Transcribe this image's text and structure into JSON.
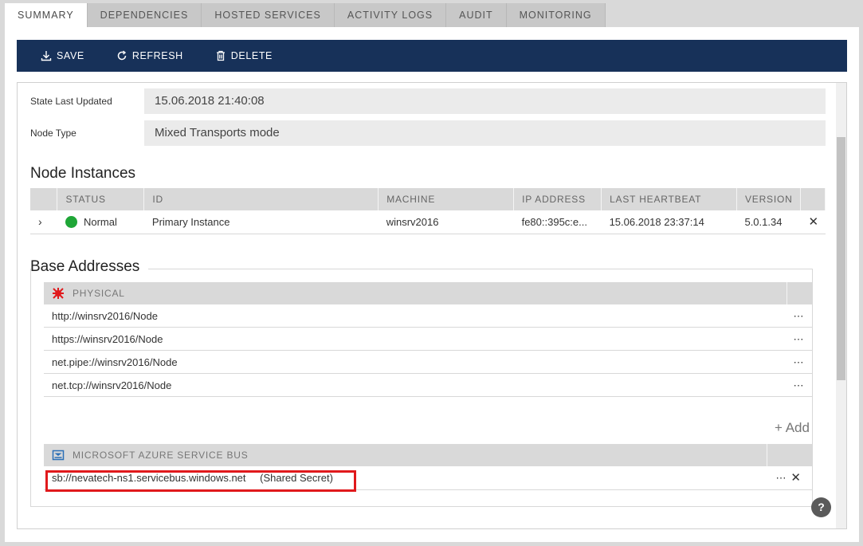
{
  "tabs": [
    {
      "label": "SUMMARY",
      "active": true
    },
    {
      "label": "DEPENDENCIES"
    },
    {
      "label": "HOSTED SERVICES"
    },
    {
      "label": "ACTIVITY LOGS"
    },
    {
      "label": "AUDIT"
    },
    {
      "label": "MONITORING"
    }
  ],
  "toolbar": {
    "save": "SAVE",
    "refresh": "REFRESH",
    "delete": "DELETE",
    "background": "#173159"
  },
  "fields": {
    "state_label": "State Last Updated",
    "state_value": "15.06.2018 21:40:08",
    "node_type_label": "Node Type",
    "node_type_value": "Mixed Transports mode"
  },
  "node_instances": {
    "title": "Node Instances",
    "columns": [
      "STATUS",
      "ID",
      "MACHINE",
      "IP ADDRESS",
      "LAST HEARTBEAT",
      "VERSION"
    ],
    "row": {
      "status": "Normal",
      "status_color": "#1fa637",
      "id": "Primary Instance",
      "machine": "winsrv2016",
      "ip": "fe80::395c:e...",
      "heartbeat": "15.06.2018 23:37:14",
      "version": "5.0.1.34"
    }
  },
  "base_addresses": {
    "title": "Base Addresses",
    "physical_header": "PHYSICAL",
    "physical_items": [
      "http://winsrv2016/Node",
      "https://winsrv2016/Node",
      "net.pipe://winsrv2016/Node",
      "net.tcp://winsrv2016/Node"
    ],
    "add_label": "+ Add",
    "azure_header": "MICROSOFT AZURE SERVICE BUS",
    "azure_item": "sb://nevatech-ns1.servicebus.windows.net",
    "azure_auth": "(Shared Secret)",
    "highlight_color": "#e0191c"
  },
  "help_label": "?"
}
